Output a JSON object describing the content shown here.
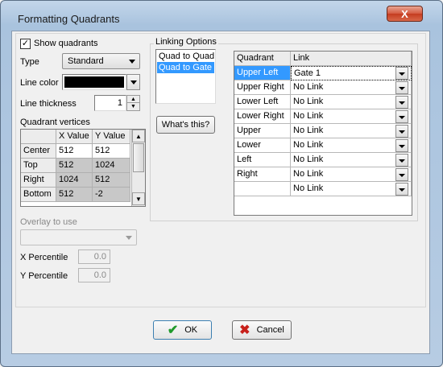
{
  "window": {
    "title": "Formatting Quadrants",
    "close_glyph": "X"
  },
  "show_quadrants": {
    "label": "Show quadrants",
    "checked": true
  },
  "type": {
    "label": "Type",
    "value": "Standard"
  },
  "line_color": {
    "label": "Line color",
    "value_hex": "#000000"
  },
  "line_thickness": {
    "label": "Line thickness",
    "value": "1"
  },
  "vertices": {
    "label": "Quadrant vertices",
    "columns": [
      "X Value",
      "Y Value"
    ],
    "rows": [
      {
        "name": "Center",
        "x": "512",
        "y": "512"
      },
      {
        "name": "Top",
        "x": "512",
        "y": "1024"
      },
      {
        "name": "Right",
        "x": "1024",
        "y": "512"
      },
      {
        "name": "Bottom",
        "x": "512",
        "y": "-2"
      }
    ]
  },
  "overlay": {
    "label": "Overlay to use",
    "value": ""
  },
  "x_percentile": {
    "label": "X Percentile",
    "value": "0.0"
  },
  "y_percentile": {
    "label": "Y Percentile",
    "value": "0.0"
  },
  "linking": {
    "legend": "Linking Options",
    "options": [
      "Quad to Quad",
      "Quad to Gate"
    ],
    "selected_index": 1,
    "whats_this": "What's this?",
    "table_headers": [
      "Quadrant",
      "Link"
    ],
    "rows": [
      {
        "quadrant": "Upper Left",
        "link": "Gate 1"
      },
      {
        "quadrant": "Upper Right",
        "link": "No Link"
      },
      {
        "quadrant": "Lower Left",
        "link": "No Link"
      },
      {
        "quadrant": "Lower Right",
        "link": "No Link"
      },
      {
        "quadrant": "Upper",
        "link": "No Link"
      },
      {
        "quadrant": "Lower",
        "link": "No Link"
      },
      {
        "quadrant": "Left",
        "link": "No Link"
      },
      {
        "quadrant": "Right",
        "link": "No Link"
      },
      {
        "quadrant": "",
        "link": "No Link"
      }
    ]
  },
  "buttons": {
    "ok": "OK",
    "cancel": "Cancel"
  },
  "colors": {
    "selection": "#3399ff",
    "ok_check": "#1f9a2b",
    "cancel_x": "#c8201a"
  }
}
